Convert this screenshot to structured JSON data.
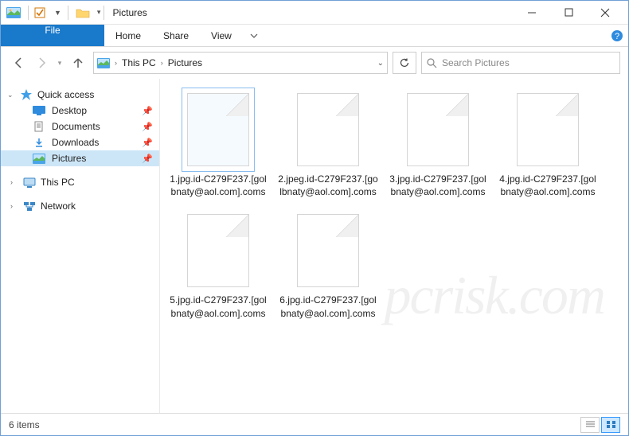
{
  "window": {
    "title": "Pictures"
  },
  "ribbon": {
    "file": "File",
    "tabs": [
      "Home",
      "Share",
      "View"
    ]
  },
  "breadcrumb": {
    "root": "This PC",
    "current": "Pictures"
  },
  "search": {
    "placeholder": "Search Pictures"
  },
  "sidebar": {
    "quick_access": {
      "label": "Quick access",
      "items": [
        {
          "label": "Desktop",
          "pin": true
        },
        {
          "label": "Documents",
          "pin": true
        },
        {
          "label": "Downloads",
          "pin": true
        },
        {
          "label": "Pictures",
          "pin": true,
          "selected": true
        }
      ]
    },
    "this_pc": {
      "label": "This PC"
    },
    "network": {
      "label": "Network"
    }
  },
  "files": [
    {
      "name": "1.jpg.id-C279F237.[golbnaty@aol.com].coms",
      "selected": true
    },
    {
      "name": "2.jpeg.id-C279F237.[golbnaty@aol.com].coms"
    },
    {
      "name": "3.jpg.id-C279F237.[golbnaty@aol.com].coms"
    },
    {
      "name": "4.jpg.id-C279F237.[golbnaty@aol.com].coms"
    },
    {
      "name": "5.jpg.id-C279F237.[golbnaty@aol.com].coms"
    },
    {
      "name": "6.jpg.id-C279F237.[golbnaty@aol.com].coms"
    }
  ],
  "status": {
    "count": "6 items"
  },
  "watermark": "pcrisk.com"
}
